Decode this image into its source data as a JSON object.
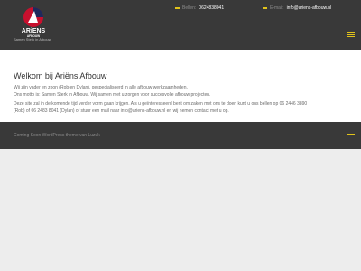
{
  "header": {
    "logo": {
      "line1": "ARiENS",
      "line2": "AFBOUW"
    },
    "tagline": "Samen Sterk in Afbouw",
    "phone": {
      "label": "Bellen:",
      "value": "0624838041"
    },
    "email": {
      "label": "E-mail:",
      "value": "info@ariens-afbouw.nl"
    },
    "colors": {
      "accent": "#e1c31b",
      "logo_red": "#c8102e",
      "logo_navy": "#1f2a5c",
      "bar_bg": "#393939"
    }
  },
  "main": {
    "title": "Welkom bij Ariëns Afbouw",
    "paragraphs": [
      "Wij zijn vader en zoon (Rob en Dylan), gespecialiseerd in alle afbouw werkzaamheden.",
      "Ons motto is: Samen Sterk in Afbouw. Wij samen met u zorgen voor succesvolle afbouw projecten.",
      "Deze site zal in de komende tijd verder vorm gaan krijgen. Als u geïnteresseerd bent om zaken met ons te doen kunt u ons bellen op 06 2446 3890",
      "(Rob) of 06 2483 8041 (Dylan) of stuur een mail naar info@ariens-afbouw.nl en wij nemen contact met u op."
    ]
  },
  "footer": {
    "credit": "Coming Soon WordPress theme van Luzuk"
  }
}
